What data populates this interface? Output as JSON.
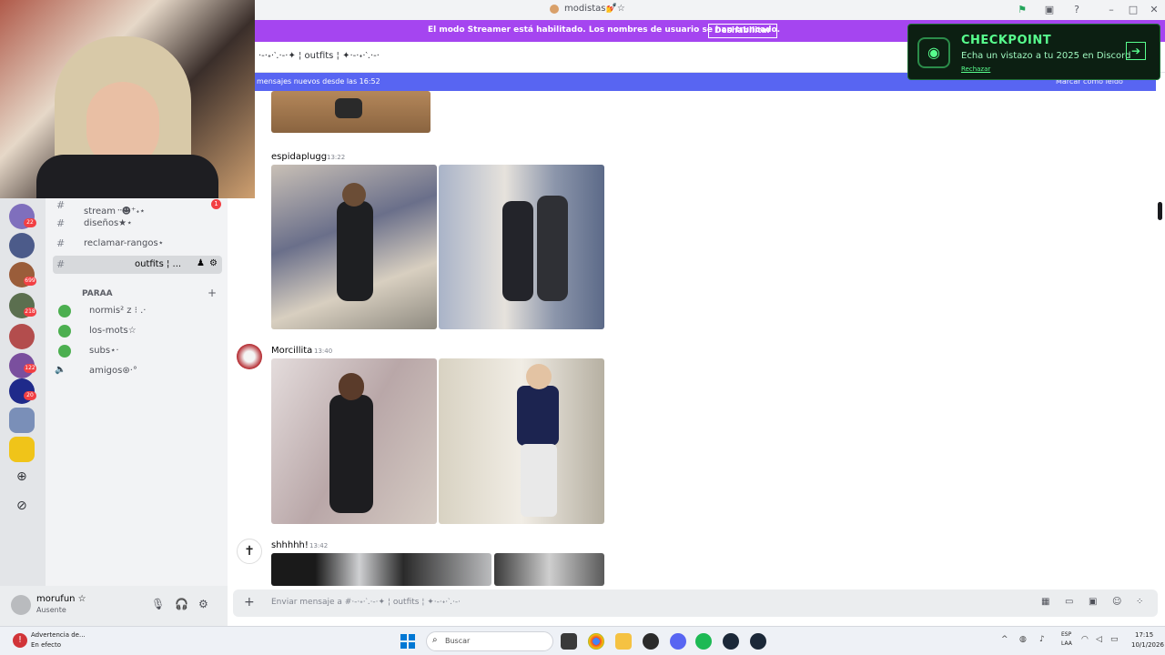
{
  "window": {
    "title": "modistas💅☆",
    "icons": [
      "flag-icon",
      "inbox-icon",
      "help-icon",
      "minimize-icon",
      "maximize-icon",
      "close-icon"
    ]
  },
  "streamer_banner": {
    "text": "El modo Streamer está habilitado. Los nombres de usuario se han truncado.",
    "button": "Deshabilitar"
  },
  "channel_header": {
    "name": "·-·˖·‵.·-·✦ ¦ outfits ¦ ✦·-·˖·‵.·-·"
  },
  "new_messages": {
    "text": "mensajes nuevos desde las 16:52",
    "mark_read": "Marcar como leído"
  },
  "checkpoint": {
    "title": "CHECKPOINT",
    "subtitle": "Echa un vistazo a tu 2025 en Discord",
    "dismiss": "Rechazar"
  },
  "server_rail": {
    "badges": [
      "22",
      "699",
      "218",
      "122",
      "20"
    ]
  },
  "channels": {
    "items": [
      {
        "label": "stream᠃☻⁺˖⋆",
        "icon": "#"
      },
      {
        "label": "diseños★⋆",
        "icon": "#"
      },
      {
        "label": "reclamar-rangos⋆",
        "icon": "#"
      },
      {
        "label": "outfits ¦ ...",
        "icon": "#"
      }
    ],
    "category": "PARAA",
    "voice_items": [
      {
        "label": "normis² z ⁝ .·"
      },
      {
        "label": "los-mots☆"
      },
      {
        "label": "subs⋆·"
      },
      {
        "label": "amigos⊛·°"
      }
    ]
  },
  "user_panel": {
    "name": "morufun ☆",
    "status": "Ausente"
  },
  "messages": [
    {
      "author": "espidaplugg",
      "time": "13:22"
    },
    {
      "author": "Morcillita",
      "time": "13:40"
    },
    {
      "author": "shhhhh!",
      "time": "13:42"
    }
  ],
  "composer": {
    "placeholder": "Enviar mensaje a #·-·˖·‵.·-·✦ ¦ outfits ¦ ✦·-·˖·‵.·-·"
  },
  "taskbar": {
    "warning_title": "Advertencia de...",
    "warning_sub": "En efecto",
    "search": "Buscar",
    "lang_top": "ESP",
    "lang_bottom": "LAA",
    "time": "17:15",
    "date": "10/1/2026"
  },
  "colors": {
    "streamer": "#a545f0",
    "blurple": "#5865f2",
    "checkpoint_green": "#58ff8e"
  }
}
